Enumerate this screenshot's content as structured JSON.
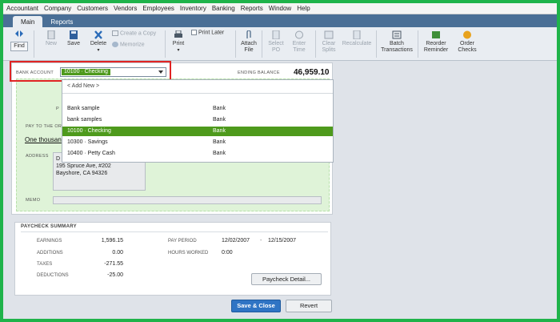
{
  "menu": [
    "Accountant",
    "Company",
    "Customers",
    "Vendors",
    "Employees",
    "Inventory",
    "Banking",
    "Reports",
    "Window",
    "Help"
  ],
  "tabs": [
    "Main",
    "Reports"
  ],
  "toolbar": {
    "find": "Find",
    "new": "New",
    "save": "Save",
    "delete": "Delete",
    "create_copy": "Create a Copy",
    "memorize": "Memorize",
    "print": "Print",
    "print_later": "Print Later",
    "attach_file": "Attach File",
    "select_po": "Select PO",
    "enter_time": "Enter Time",
    "clear_splits": "Clear Splits",
    "recalculate": "Recalculate",
    "batch_transactions": "Batch Transactions",
    "reorder_reminder": "Reorder Reminder",
    "order_checks": "Order Checks"
  },
  "form": {
    "bank_account_label": "BANK ACCOUNT",
    "bank_account_value": "10100 · Checking",
    "ending_balance_label": "ENDING BALANCE",
    "ending_balance_value": "46,959.10",
    "p_label": "P",
    "pay_to_label": "PAY TO THE OR",
    "amount_words": "One thousan",
    "address_label": "ADDRESS",
    "address_prefix": "D",
    "address_lines": "195 Spruce Ave, #202\nBayshore, CA 94326",
    "memo_label": "MEMO"
  },
  "dropdown": {
    "add_new": "< Add New >",
    "items": [
      {
        "name": "Bank sample",
        "type": "Bank"
      },
      {
        "name": "bank samples",
        "type": "Bank"
      },
      {
        "name": "10100 · Checking",
        "type": "Bank"
      },
      {
        "name": "10300 · Savings",
        "type": "Bank"
      },
      {
        "name": "10400 · Petty Cash",
        "type": "Bank"
      }
    ],
    "selected_index": 2
  },
  "summary": {
    "title": "PAYCHECK SUMMARY",
    "earnings_label": "EARNINGS",
    "earnings": "1,596.15",
    "additions_label": "ADDITIONS",
    "additions": "0.00",
    "taxes_label": "TAXES",
    "taxes": "-271.55",
    "deductions_label": "DEDUCTIONS",
    "deductions": "-25.00",
    "pay_period_label": "PAY PERIOD",
    "pay_period_start": "12/02/2007",
    "pay_period_sep": "-",
    "pay_period_end": "12/15/2007",
    "hours_worked_label": "HOURS WORKED",
    "hours_worked": "0:00",
    "detail_button": "Paycheck Detail..."
  },
  "buttons": {
    "save_close": "Save & Close",
    "revert": "Revert"
  },
  "colors": {
    "frame": "#1fb34a",
    "highlight": "#4e9a1c",
    "callout": "#e02424",
    "save_button": "#2f74c4"
  }
}
